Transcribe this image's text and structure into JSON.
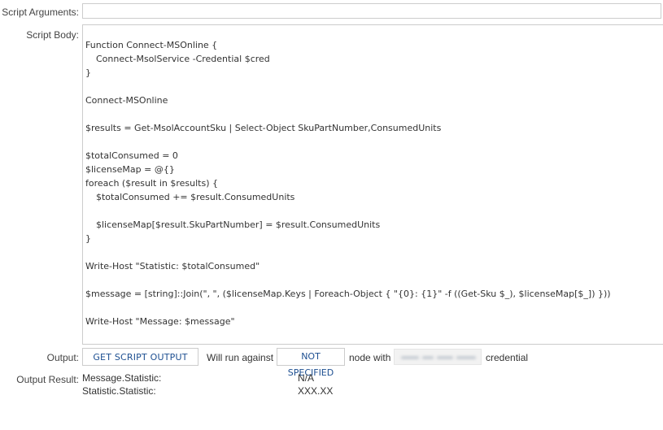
{
  "form": {
    "script_arguments_label": "Script Arguments:",
    "script_arguments_value": "",
    "script_body_label": "Script Body:",
    "output_label": "Output:",
    "output_result_label": "Output Result:"
  },
  "script_body": {
    "lines": [
      {
        "text": "Function Connect-MSOnline {",
        "indent": false
      },
      {
        "text": "Connect-MsolService -Credential $cred",
        "indent": true
      },
      {
        "text": "}",
        "indent": false
      },
      {
        "text": "",
        "indent": false
      },
      {
        "text": "Connect-MSOnline",
        "indent": false
      },
      {
        "text": "",
        "indent": false
      },
      {
        "text": "$results = Get-MsolAccountSku | Select-Object SkuPartNumber,ConsumedUnits",
        "indent": false
      },
      {
        "text": "",
        "indent": false
      },
      {
        "text": "$totalConsumed = 0",
        "indent": false
      },
      {
        "text": "$licenseMap = @{}",
        "indent": false
      },
      {
        "text": "foreach ($result in $results) {",
        "indent": false
      },
      {
        "text": "$totalConsumed += $result.ConsumedUnits",
        "indent": true
      },
      {
        "text": "",
        "indent": false
      },
      {
        "text": "$licenseMap[$result.SkuPartNumber] = $result.ConsumedUnits",
        "indent": true
      },
      {
        "text": "}",
        "indent": false
      },
      {
        "text": "",
        "indent": false
      },
      {
        "text": "Write-Host \"Statistic: $totalConsumed\"",
        "indent": false
      },
      {
        "text": "",
        "indent": false
      },
      {
        "text": "$message = [string]::Join(\", \", ($licenseMap.Keys | Foreach-Object { \"{0}: {1}\" -f ((Get-Sku $_), $licenseMap[$_]) }))",
        "indent": false
      },
      {
        "text": "",
        "indent": false
      },
      {
        "text": "Write-Host \"Message: $message\"",
        "indent": false
      }
    ]
  },
  "output": {
    "button_label": "GET SCRIPT OUTPUT",
    "will_run_text": "Will run against",
    "node_value": "NOT SPECIFIED",
    "node_with_text": "node with",
    "credential_text": "credential"
  },
  "results": [
    {
      "name": "Message.Statistic:",
      "value": "N/A"
    },
    {
      "name": "Statistic.Statistic:",
      "value": "XXX.XX"
    }
  ],
  "colors": {
    "link_blue": "#1d4f91",
    "border_gray": "#cccccc",
    "text": "#333333"
  }
}
